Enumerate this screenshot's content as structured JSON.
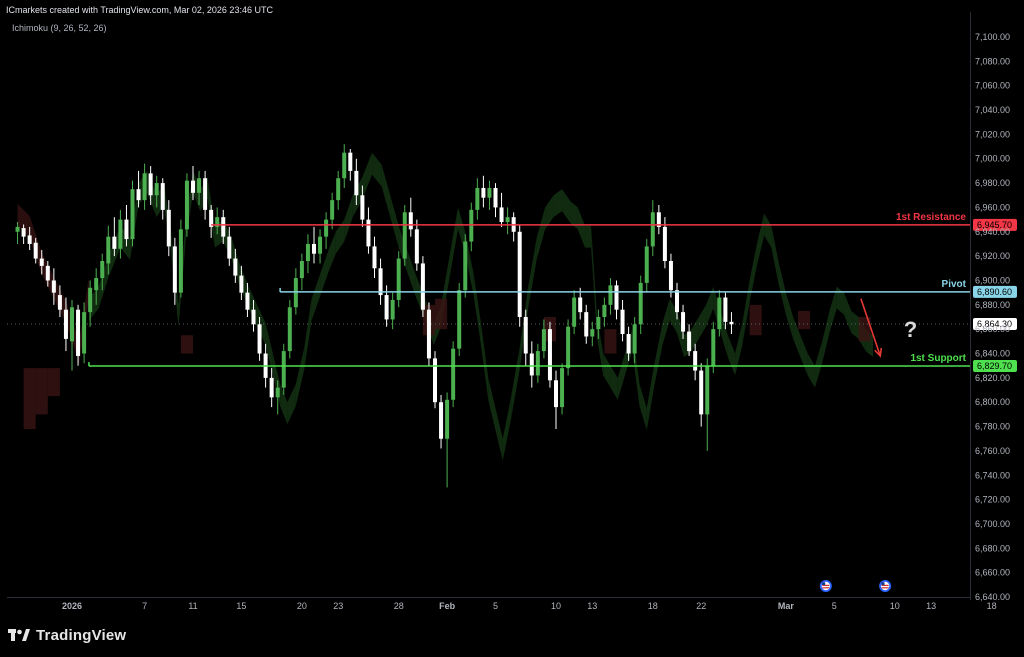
{
  "header": {
    "credit": "ICmarkets created with TradingView.com, Mar 02, 2026 23:46 UTC",
    "indicator": "Ichimoku (9, 26, 52, 26)"
  },
  "branding": {
    "text": "TradingView",
    "logo_icon": "tradingview-logo-icon"
  },
  "colors": {
    "background": "#000000",
    "bull_candle": "#4caf50",
    "bear_candle": "#ffffff",
    "resistance": "#f23645",
    "pivot": "#89d4e8",
    "support": "#4ee04e",
    "cloud_bull": "#163a16",
    "cloud_bear": "#3a1414",
    "arrow": "#e53935",
    "question": "#d8d8d8"
  },
  "annotations": {
    "question_mark": "?",
    "arrow_icon": "down-arrow-icon",
    "event_icon": "us-flag-event-icon"
  },
  "chart_data": {
    "type": "candlestick",
    "ylim": [
      6630,
      7110
    ],
    "y_ticks": [
      7100,
      7080,
      7060,
      7040,
      7020,
      7000,
      6980,
      6960,
      6940,
      6920,
      6900,
      6880,
      6860,
      6840,
      6820,
      6800,
      6780,
      6760,
      6740,
      6720,
      6700,
      6680,
      6660,
      6640
    ],
    "y_tick_labels": [
      "7,100.00",
      "7,080.00",
      "7,060.00",
      "7,040.00",
      "7,020.00",
      "7,000.00",
      "6,980.00",
      "6,960.00",
      "6,940.00",
      "6,920.00",
      "6,900.00",
      "6,880.00",
      "6,860.00",
      "6,840.00",
      "6,820.00",
      "6,800.00",
      "6,780.00",
      "6,760.00",
      "6,740.00",
      "6,720.00",
      "6,700.00",
      "6,680.00",
      "6,660.00",
      "6,640.00"
    ],
    "x_ticks": [
      "2026",
      "7",
      "11",
      "15",
      "20",
      "23",
      "28",
      "Feb",
      "5",
      "10",
      "13",
      "18",
      "22",
      "Mar",
      "5",
      "10",
      "13",
      "18"
    ],
    "x_tick_days": [
      1,
      7,
      11,
      15,
      20,
      23,
      28,
      32,
      36,
      41,
      44,
      49,
      53,
      60,
      64,
      69,
      72,
      77
    ],
    "x_range_days": [
      -3.5,
      82
    ],
    "last_price": {
      "value": 6864.3,
      "label": "6,864.30"
    },
    "levels": [
      {
        "name": "1st Resistance",
        "value": 6945.7,
        "label": "6,945.70",
        "start_day": 12.5,
        "role": "resistance"
      },
      {
        "name": "Pivot",
        "value": 6890.6,
        "label": "6,890.60",
        "start_day": 18.2,
        "role": "pivot"
      },
      {
        "name": "1st Support",
        "value": 6829.7,
        "label": "6,829.70",
        "start_day": 2.4,
        "role": "support"
      }
    ],
    "arrow": {
      "from": [
        66.2,
        6885
      ],
      "to": [
        67.8,
        6838
      ]
    },
    "question_at": [
      70.3,
      6860
    ],
    "events_days": [
      63.3,
      68.2
    ],
    "segments": [
      [
        -3.5,
        6945,
        0
      ],
      [
        -2.5,
        6935,
        0
      ],
      [
        -1.5,
        6905,
        0
      ],
      [
        -0.5,
        6885,
        0
      ],
      [
        0.5,
        6865,
        0
      ],
      [
        1.6,
        6832,
        0
      ],
      [
        2.4,
        6885,
        1
      ],
      [
        3.2,
        6895,
        1
      ],
      [
        4.0,
        6920,
        1
      ],
      [
        5.0,
        6945,
        1
      ],
      [
        5.8,
        6935,
        1
      ],
      [
        6.5,
        6980,
        1
      ],
      [
        7.2,
        6990,
        1
      ],
      [
        8.0,
        6970,
        1
      ],
      [
        8.6,
        6980,
        1
      ],
      [
        9.2,
        6940,
        1
      ],
      [
        9.8,
        6880,
        1
      ],
      [
        10.4,
        6950,
        1
      ],
      [
        11.0,
        6990,
        1
      ],
      [
        11.6,
        6975,
        1
      ],
      [
        12.2,
        6985,
        1
      ],
      [
        12.8,
        6945,
        1
      ],
      [
        13.5,
        6950,
        1
      ],
      [
        14.2,
        6935,
        1
      ],
      [
        14.8,
        6915,
        1
      ],
      [
        15.6,
        6895,
        1
      ],
      [
        16.3,
        6880,
        1
      ],
      [
        17.0,
        6865,
        1
      ],
      [
        17.6,
        6840,
        1
      ],
      [
        18.2,
        6815,
        1
      ],
      [
        18.8,
        6800,
        1
      ],
      [
        19.5,
        6815,
        1
      ],
      [
        20.2,
        6845,
        1
      ],
      [
        20.8,
        6885,
        1
      ],
      [
        21.5,
        6905,
        1
      ],
      [
        22.2,
        6925,
        1
      ],
      [
        22.8,
        6940,
        1
      ],
      [
        23.5,
        6950,
        1
      ],
      [
        24.2,
        6970,
        1
      ],
      [
        25.0,
        6985,
        1
      ],
      [
        25.8,
        7005,
        1
      ],
      [
        26.6,
        6995,
        1
      ],
      [
        27.3,
        6970,
        1
      ],
      [
        28.0,
        6945,
        1
      ],
      [
        28.7,
        6925,
        1
      ],
      [
        29.4,
        6905,
        1
      ],
      [
        30.2,
        6885,
        1
      ],
      [
        30.9,
        6865,
        1
      ],
      [
        31.5,
        6880,
        1
      ],
      [
        32.2,
        6920,
        1
      ],
      [
        32.9,
        6960,
        1
      ],
      [
        33.5,
        6940,
        1
      ],
      [
        34.2,
        6905,
        1
      ],
      [
        34.8,
        6865,
        1
      ],
      [
        35.4,
        6820,
        1
      ],
      [
        36.0,
        6795,
        1
      ],
      [
        36.6,
        6770,
        1
      ],
      [
        37.3,
        6805,
        1
      ],
      [
        38.0,
        6845,
        1
      ],
      [
        38.7,
        6895,
        1
      ],
      [
        39.4,
        6935,
        1
      ],
      [
        40.1,
        6960,
        1
      ],
      [
        40.8,
        6970,
        1
      ],
      [
        41.5,
        6975,
        1
      ],
      [
        42.2,
        6965,
        1
      ],
      [
        42.8,
        6960,
        1
      ],
      [
        43.4,
        6945,
        1
      ],
      [
        43.9,
        6945,
        1
      ],
      [
        44.4,
        6870,
        1
      ],
      [
        44.9,
        6840,
        1
      ],
      [
        45.5,
        6830,
        1
      ],
      [
        46.1,
        6820,
        1
      ],
      [
        46.7,
        6840,
        1
      ],
      [
        47.3,
        6860,
        1
      ],
      [
        47.9,
        6815,
        1
      ],
      [
        48.5,
        6795,
        1
      ],
      [
        49.1,
        6830,
        1
      ],
      [
        49.8,
        6865,
        1
      ],
      [
        50.4,
        6885,
        1
      ],
      [
        51.0,
        6875,
        1
      ],
      [
        51.6,
        6855,
        1
      ],
      [
        52.2,
        6860,
        1
      ],
      [
        52.8,
        6870,
        1
      ],
      [
        53.4,
        6880,
        1
      ],
      [
        54.0,
        6895,
        1
      ],
      [
        54.6,
        6875,
        1
      ],
      [
        55.2,
        6855,
        1
      ],
      [
        55.8,
        6840,
        1
      ],
      [
        56.4,
        6865,
        1
      ],
      [
        57.0,
        6900,
        1
      ],
      [
        57.6,
        6930,
        1
      ],
      [
        58.2,
        6955,
        1
      ],
      [
        58.8,
        6945,
        1
      ],
      [
        59.4,
        6915,
        1
      ],
      [
        60.0,
        6890,
        1
      ],
      [
        60.6,
        6870,
        1
      ],
      [
        61.2,
        6855,
        1
      ],
      [
        61.8,
        6840,
        1
      ],
      [
        62.4,
        6830,
        1
      ],
      [
        63.0,
        6850,
        1
      ],
      [
        63.6,
        6875,
        1
      ],
      [
        64.2,
        6895,
        1
      ],
      [
        64.8,
        6890,
        1
      ],
      [
        65.4,
        6875,
        1
      ],
      [
        66.0,
        6870,
        1
      ],
      [
        66.6,
        6860,
        1
      ],
      [
        67.2,
        6855,
        1
      ]
    ],
    "kijun_blocks": [
      [
        -3,
        -2,
        6828,
        6778
      ],
      [
        -2,
        -1,
        6828,
        6790
      ],
      [
        -1,
        0,
        6828,
        6805
      ],
      [
        10,
        11,
        6840,
        6855
      ],
      [
        30,
        31,
        6880,
        6855
      ],
      [
        31,
        32,
        6885,
        6860
      ],
      [
        40,
        41,
        6870,
        6850
      ],
      [
        45,
        46,
        6860,
        6840
      ],
      [
        57,
        58,
        6880,
        6855
      ],
      [
        61,
        62,
        6875,
        6860
      ],
      [
        66,
        67,
        6870,
        6850
      ]
    ],
    "candles": [
      [
        -3.5,
        6940,
        6948,
        6930,
        6944
      ],
      [
        -3.0,
        6943,
        6946,
        6930,
        6936
      ],
      [
        -2.5,
        6937,
        6944,
        6925,
        6930
      ],
      [
        -2.0,
        6931,
        6935,
        6914,
        6918
      ],
      [
        -1.5,
        6918,
        6925,
        6905,
        6912
      ],
      [
        -1.0,
        6912,
        6916,
        6895,
        6900
      ],
      [
        -0.5,
        6900,
        6910,
        6880,
        6890
      ],
      [
        0.0,
        6888,
        6896,
        6870,
        6876
      ],
      [
        0.5,
        6876,
        6886,
        6842,
        6852
      ],
      [
        1.0,
        6850,
        6884,
        6826,
        6878
      ],
      [
        1.5,
        6876,
        6880,
        6830,
        6838
      ],
      [
        2.0,
        6840,
        6882,
        6832,
        6874
      ],
      [
        2.5,
        6874,
        6900,
        6862,
        6894
      ],
      [
        3.0,
        6892,
        6910,
        6880,
        6902
      ],
      [
        3.5,
        6902,
        6922,
        6892,
        6916
      ],
      [
        4.0,
        6914,
        6945,
        6905,
        6936
      ],
      [
        4.5,
        6936,
        6952,
        6920,
        6926
      ],
      [
        5.0,
        6926,
        6958,
        6918,
        6950
      ],
      [
        5.5,
        6950,
        6962,
        6928,
        6934
      ],
      [
        6.0,
        6934,
        6982,
        6928,
        6975
      ],
      [
        6.5,
        6975,
        6990,
        6960,
        6966
      ],
      [
        7.0,
        6966,
        6996,
        6958,
        6988
      ],
      [
        7.5,
        6988,
        6994,
        6962,
        6970
      ],
      [
        8.0,
        6970,
        6986,
        6960,
        6980
      ],
      [
        8.5,
        6980,
        6984,
        6950,
        6958
      ],
      [
        9.0,
        6958,
        6966,
        6920,
        6928
      ],
      [
        9.5,
        6928,
        6935,
        6880,
        6890
      ],
      [
        10.0,
        6890,
        6950,
        6886,
        6942
      ],
      [
        10.5,
        6942,
        6988,
        6936,
        6982
      ],
      [
        11.0,
        6982,
        6994,
        6966,
        6972
      ],
      [
        11.5,
        6972,
        6990,
        6962,
        6984
      ],
      [
        12.0,
        6984,
        6990,
        6950,
        6958
      ],
      [
        12.5,
        6958,
        6962,
        6935,
        6944
      ],
      [
        13.0,
        6944,
        6960,
        6938,
        6952
      ],
      [
        13.5,
        6952,
        6958,
        6930,
        6936
      ],
      [
        14.0,
        6936,
        6944,
        6912,
        6918
      ],
      [
        14.5,
        6918,
        6926,
        6898,
        6904
      ],
      [
        15.0,
        6904,
        6912,
        6884,
        6890
      ],
      [
        15.5,
        6890,
        6898,
        6870,
        6876
      ],
      [
        16.0,
        6876,
        6884,
        6858,
        6864
      ],
      [
        16.5,
        6864,
        6870,
        6834,
        6840
      ],
      [
        17.0,
        6840,
        6848,
        6812,
        6820
      ],
      [
        17.5,
        6820,
        6828,
        6796,
        6804
      ],
      [
        18.0,
        6804,
        6818,
        6790,
        6812
      ],
      [
        18.5,
        6812,
        6848,
        6806,
        6842
      ],
      [
        19.0,
        6842,
        6884,
        6836,
        6878
      ],
      [
        19.5,
        6878,
        6910,
        6872,
        6902
      ],
      [
        20.0,
        6902,
        6922,
        6892,
        6916
      ],
      [
        20.5,
        6916,
        6938,
        6906,
        6930
      ],
      [
        21.0,
        6930,
        6944,
        6914,
        6922
      ],
      [
        21.5,
        6922,
        6942,
        6914,
        6936
      ],
      [
        22.0,
        6936,
        6956,
        6926,
        6950
      ],
      [
        22.5,
        6950,
        6972,
        6942,
        6966
      ],
      [
        23.0,
        6966,
        6990,
        6958,
        6984
      ],
      [
        23.5,
        6984,
        7012,
        6976,
        7005
      ],
      [
        24.0,
        7005,
        7008,
        6982,
        6990
      ],
      [
        24.5,
        6990,
        7000,
        6962,
        6970
      ],
      [
        25.0,
        6970,
        6978,
        6944,
        6950
      ],
      [
        25.5,
        6950,
        6960,
        6922,
        6928
      ],
      [
        26.0,
        6928,
        6936,
        6902,
        6910
      ],
      [
        26.5,
        6910,
        6918,
        6880,
        6888
      ],
      [
        27.0,
        6888,
        6896,
        6862,
        6868
      ],
      [
        27.5,
        6868,
        6890,
        6860,
        6884
      ],
      [
        28.0,
        6884,
        6924,
        6878,
        6918
      ],
      [
        28.5,
        6918,
        6962,
        6912,
        6956
      ],
      [
        29.0,
        6956,
        6968,
        6936,
        6942
      ],
      [
        29.5,
        6942,
        6950,
        6908,
        6914
      ],
      [
        30.0,
        6914,
        6920,
        6870,
        6876
      ],
      [
        30.5,
        6876,
        6882,
        6830,
        6836
      ],
      [
        31.0,
        6836,
        6842,
        6795,
        6800
      ],
      [
        31.5,
        6800,
        6806,
        6762,
        6770
      ],
      [
        32.0,
        6770,
        6808,
        6730,
        6802
      ],
      [
        32.5,
        6802,
        6850,
        6796,
        6844
      ],
      [
        33.0,
        6844,
        6898,
        6838,
        6892
      ],
      [
        33.5,
        6892,
        6938,
        6886,
        6932
      ],
      [
        34.0,
        6932,
        6964,
        6924,
        6958
      ],
      [
        34.5,
        6958,
        6984,
        6950,
        6976
      ],
      [
        35.0,
        6976,
        6986,
        6960,
        6968
      ],
      [
        35.5,
        6968,
        6982,
        6958,
        6976
      ],
      [
        36.0,
        6976,
        6980,
        6952,
        6960
      ],
      [
        36.5,
        6960,
        6972,
        6944,
        6948
      ],
      [
        37.0,
        6948,
        6960,
        6938,
        6952
      ],
      [
        37.5,
        6952,
        6956,
        6932,
        6940
      ],
      [
        38.0,
        6940,
        6946,
        6862,
        6870
      ],
      [
        38.5,
        6870,
        6876,
        6830,
        6840
      ],
      [
        39.0,
        6840,
        6850,
        6812,
        6822
      ],
      [
        39.5,
        6822,
        6848,
        6816,
        6842
      ],
      [
        40.0,
        6842,
        6868,
        6836,
        6860
      ],
      [
        40.5,
        6860,
        6866,
        6812,
        6818
      ],
      [
        41.0,
        6818,
        6826,
        6778,
        6796
      ],
      [
        41.5,
        6796,
        6832,
        6790,
        6828
      ],
      [
        42.0,
        6828,
        6868,
        6822,
        6862
      ],
      [
        42.5,
        6862,
        6892,
        6856,
        6886
      ],
      [
        43.0,
        6886,
        6894,
        6868,
        6874
      ],
      [
        43.5,
        6874,
        6880,
        6848,
        6854
      ],
      [
        44.0,
        6854,
        6866,
        6846,
        6860
      ],
      [
        44.5,
        6860,
        6876,
        6852,
        6870
      ],
      [
        45.0,
        6870,
        6886,
        6862,
        6880
      ],
      [
        45.5,
        6880,
        6902,
        6872,
        6896
      ],
      [
        46.0,
        6896,
        6900,
        6868,
        6876
      ],
      [
        46.5,
        6876,
        6884,
        6850,
        6856
      ],
      [
        47.0,
        6856,
        6862,
        6834,
        6840
      ],
      [
        47.5,
        6840,
        6870,
        6832,
        6864
      ],
      [
        48.0,
        6864,
        6904,
        6856,
        6898
      ],
      [
        48.5,
        6898,
        6934,
        6890,
        6928
      ],
      [
        49.0,
        6928,
        6966,
        6920,
        6956
      ],
      [
        49.5,
        6956,
        6962,
        6938,
        6944
      ],
      [
        50.0,
        6944,
        6952,
        6910,
        6916
      ],
      [
        50.5,
        6916,
        6922,
        6886,
        6892
      ],
      [
        51.0,
        6892,
        6898,
        6868,
        6874
      ],
      [
        51.5,
        6874,
        6880,
        6852,
        6858
      ],
      [
        52.0,
        6858,
        6864,
        6838,
        6842
      ],
      [
        52.5,
        6842,
        6848,
        6818,
        6826
      ],
      [
        53.0,
        6826,
        6832,
        6780,
        6790
      ],
      [
        53.5,
        6790,
        6836,
        6760,
        6830
      ],
      [
        54.0,
        6830,
        6866,
        6824,
        6860
      ],
      [
        54.5,
        6860,
        6892,
        6854,
        6886
      ],
      [
        55.0,
        6886,
        6890,
        6860,
        6866
      ],
      [
        55.5,
        6866,
        6874,
        6856,
        6864
      ]
    ]
  }
}
